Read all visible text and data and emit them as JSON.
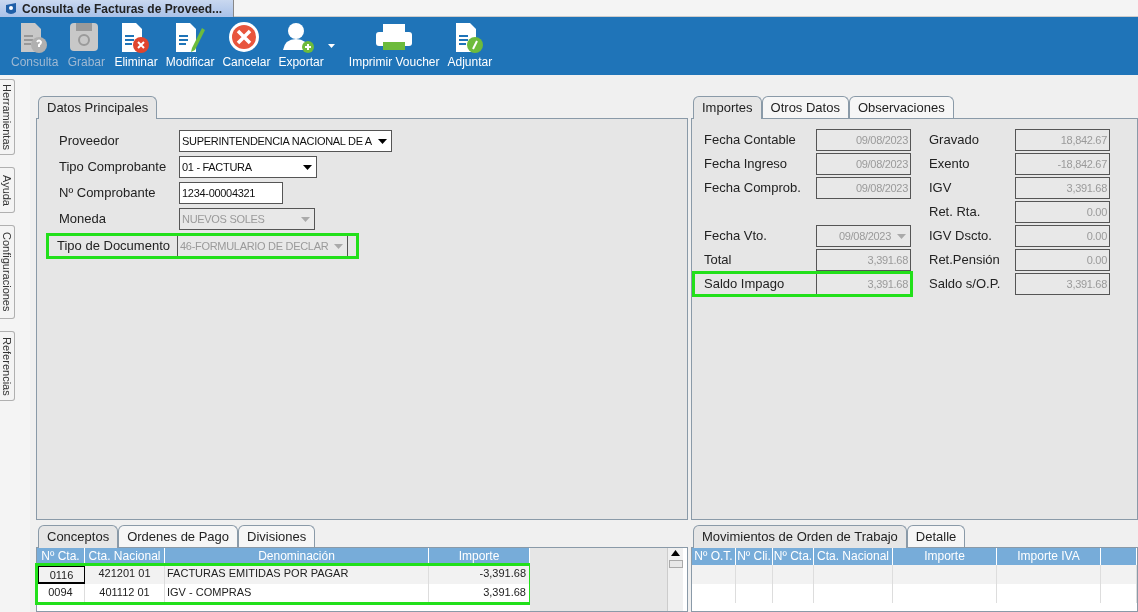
{
  "window": {
    "title": "Consulta de Facturas de Proveed..."
  },
  "toolbar": [
    {
      "label": "Consulta",
      "kind": "consulta",
      "disabled": true,
      "dropdown": false
    },
    {
      "label": "Grabar",
      "kind": "grabar",
      "disabled": true,
      "dropdown": false
    },
    {
      "label": "Eliminar",
      "kind": "eliminar",
      "disabled": false,
      "dropdown": false
    },
    {
      "label": "Modificar",
      "kind": "modificar",
      "disabled": false,
      "dropdown": false
    },
    {
      "label": "Cancelar",
      "kind": "cancelar",
      "disabled": false,
      "dropdown": false
    },
    {
      "label": "Exportar",
      "kind": "exportar",
      "disabled": false,
      "dropdown": true
    },
    {
      "label": "Imprimir Voucher",
      "kind": "imprimir",
      "disabled": false,
      "dropdown": false
    },
    {
      "label": "Adjuntar",
      "kind": "adjuntar",
      "disabled": false,
      "dropdown": false
    }
  ],
  "side_tabs": [
    "Herramientas",
    "Ayuda",
    "Configuraciones",
    "Referencias"
  ],
  "main_panel": {
    "tabs": [
      {
        "label": "Datos Principales",
        "selected": true
      }
    ],
    "fields": [
      {
        "label": "Proveedor",
        "value": "SUPERINTENDENCIA NACIONAL DE A",
        "kind": "combo",
        "disabled": false,
        "highlighted": false
      },
      {
        "label": "Tipo Comprobante",
        "value": "01 - FACTURA",
        "kind": "combo",
        "disabled": false,
        "highlighted": false
      },
      {
        "label": "Nº Comprobante",
        "value": "1234-00004321",
        "kind": "text",
        "disabled": false,
        "highlighted": false
      },
      {
        "label": "Moneda",
        "value": "NUEVOS SOLES",
        "kind": "combo",
        "disabled": true,
        "highlighted": false
      },
      {
        "label": "Tipo de Documento",
        "value": "46-FORMULARIO DE DECLAR",
        "kind": "combo",
        "disabled": true,
        "highlighted": true
      }
    ]
  },
  "amounts_panel": {
    "tabs": [
      {
        "label": "Importes",
        "selected": true
      },
      {
        "label": "Otros Datos",
        "selected": false
      },
      {
        "label": "Observaciones",
        "selected": false
      }
    ],
    "left_fields": [
      {
        "label": "Fecha Contable",
        "value": "09/08/2023",
        "kind": "text",
        "highlighted": false
      },
      {
        "label": "Fecha Ingreso",
        "value": "09/08/2023",
        "kind": "text",
        "highlighted": false
      },
      {
        "label": "Fecha Comprob.",
        "value": "09/08/2023",
        "kind": "text",
        "highlighted": false
      },
      {
        "label": "Fecha Vto.",
        "value": "09/08/2023",
        "kind": "combo",
        "highlighted": false
      },
      {
        "label": "Total",
        "value": "3,391.68",
        "kind": "text",
        "highlighted": false
      },
      {
        "label": "Saldo Impago",
        "value": "3,391.68",
        "kind": "text",
        "highlighted": true
      }
    ],
    "right_fields": [
      {
        "label": "Gravado",
        "value": "18,842.67"
      },
      {
        "label": "Exento",
        "value": "-18,842.67"
      },
      {
        "label": "IGV",
        "value": "3,391.68"
      },
      {
        "label": "Ret. Rta.",
        "value": "0.00"
      },
      {
        "label": "IGV Dscto.",
        "value": "0.00"
      },
      {
        "label": "Ret.Pensión",
        "value": "0.00"
      },
      {
        "label": "Saldo s/O.P.",
        "value": "3,391.68"
      }
    ]
  },
  "concepts_panel": {
    "tabs": [
      {
        "label": "Conceptos",
        "selected": true
      },
      {
        "label": "Ordenes de Pago",
        "selected": false
      },
      {
        "label": "Divisiones",
        "selected": false
      }
    ],
    "columns": [
      "Nº Cta.",
      "Cta. Nacional",
      "Denominación",
      "Importe"
    ],
    "rows_highlighted": true,
    "rows": [
      {
        "cells": [
          "0116",
          "421201 01",
          "FACTURAS EMITIDAS POR PAGAR",
          "-3,391.68"
        ],
        "focused": true
      },
      {
        "cells": [
          "0094",
          "401112 01",
          "IGV - COMPRAS",
          "3,391.68"
        ],
        "focused": false
      }
    ]
  },
  "work_orders_panel": {
    "tabs": [
      {
        "label": "Movimientos de Orden de Trabajo",
        "selected": true
      },
      {
        "label": "Detalle",
        "selected": false
      }
    ],
    "columns": [
      "Nº O.T.",
      "Nº Cli.",
      "Nº Cta.",
      "Cta. Nacional",
      "Importe",
      "Importe IVA"
    ]
  }
}
